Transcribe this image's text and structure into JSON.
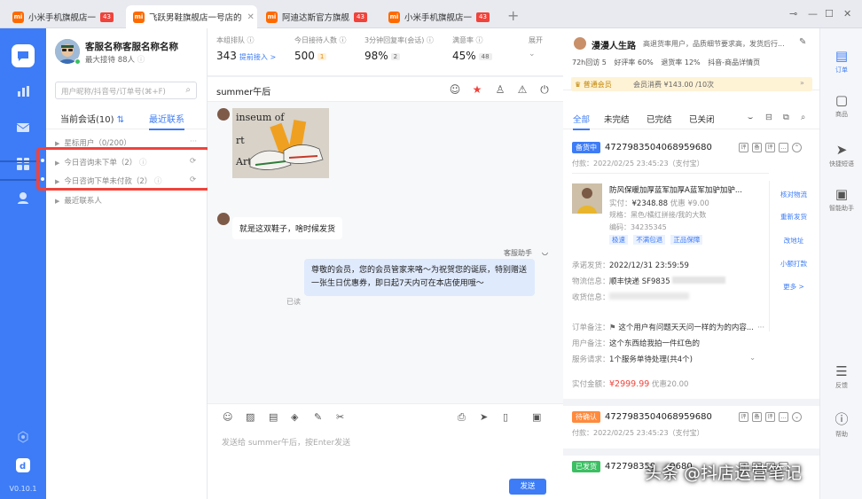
{
  "tabs": [
    {
      "label": "小米手机旗舰店一",
      "count": "43",
      "active": false
    },
    {
      "label": "飞跃男鞋旗舰店一号店的",
      "active": true
    },
    {
      "label": "阿迪达斯官方旗舰",
      "count": "43",
      "active": false
    },
    {
      "label": "小米手机旗舰店一",
      "count": "43",
      "active": false
    }
  ],
  "tab_icon": "mi",
  "nav": {
    "version": "V0.10.1"
  },
  "profile": {
    "name": "客服名称客服名称名称",
    "status": "最大接待 88人"
  },
  "search": {
    "placeholder": "用户昵称/抖音号/订单号(⌘+F)"
  },
  "conv_tabs": {
    "current": "当前会话(10)",
    "recent": "最近联系"
  },
  "groups": {
    "star": "星标用户（0/200）",
    "g1": "今日咨询未下单（2）",
    "g2": "今日咨询下单未付款（2）",
    "recent": "最近联系人"
  },
  "stats": [
    {
      "label": "本组排队",
      "value": "343",
      "link": "提前接入 >"
    },
    {
      "label": "今日接待人数",
      "value": "500",
      "tag": "1"
    },
    {
      "label": "3分钟回复率(会话)",
      "value": "98%",
      "tag": "2"
    },
    {
      "label": "满意率",
      "value": "45%",
      "tag": "48"
    },
    {
      "label": "展开"
    }
  ],
  "chat": {
    "name": "summer午后",
    "photo_text": [
      "inseum of",
      "rt",
      "Art"
    ],
    "msg1": "就是这双鞋子，啥时候发货",
    "bot_label": "客服助手",
    "msg2": "尊敬的会员，您的会员管家来咯～为祝贺您的诞辰，特别赠送一张生日优惠券，即日起7天内可在本店使用哦～",
    "read": "已读"
  },
  "input": {
    "placeholder": "发送给 summer午后，按Enter发送",
    "send": "发送"
  },
  "customer": {
    "name": "漫漫人生路",
    "tags": "高退货率用户，品质细节要求高，发货后行...",
    "visits": "72h回访 5",
    "good_rate": "好评率 60%",
    "refund_rate": "退货率 12%",
    "platform": "抖音-商品详情页",
    "member_level": "普通会员",
    "member_spend": "会员消费 ¥143.00 /10次"
  },
  "order_tabs": [
    "全部",
    "未完结",
    "已完结",
    "已关闭"
  ],
  "order1": {
    "status": "备货中",
    "status_color": "#3d7cf6",
    "number": "4727983504068959680",
    "paid": "付款：2022/02/25 23:45:23（支付宝）",
    "product_title": "防风保暖加厚蓝军加厚A蓝军加驴加驴...",
    "price": "¥2348.88",
    "discount": "优惠 ¥9.00",
    "spec": "规格：黑色/橘红拼接/我的大数",
    "code": "编码：34235345",
    "tags": [
      "极速",
      "不满包退",
      "正品保障"
    ],
    "actions": [
      "核对物流",
      "重新发货",
      "改地址",
      "小额打款",
      "更多 >"
    ],
    "ship_time_k": "承诺发货：",
    "ship_time": "2022/12/31 23:59:59",
    "logistics_k": "物流信息：",
    "logistics": "顺丰快递 SF9835",
    "address_k": "收货信息：",
    "remark_k": "订单备注：",
    "remark": "这个用户有问题天天问一样的为的内容...",
    "user_remark_k": "用户备注：",
    "user_remark": "这个东西给我拍一件红色的",
    "service_k": "服务请求：",
    "service": "1个服务单待处理(共4个)",
    "total_k": "实付金额：",
    "total": "¥2999.99",
    "total_discount": "优惠20.00"
  },
  "order2": {
    "status": "待确认",
    "status_color": "#ff8a3d",
    "number": "4727983504068959680",
    "paid": "付款：2022/02/25 23:45:23（支付宝）"
  },
  "order3": {
    "status": "已发货",
    "status_color": "#3bbf62",
    "number": "472798350",
    "number_tail": "9680"
  },
  "rightbar": [
    "订单",
    "商品",
    "快捷短语",
    "智能助手",
    "反馈",
    "帮助"
  ],
  "watermark": "头条 @抖店运营笔记"
}
